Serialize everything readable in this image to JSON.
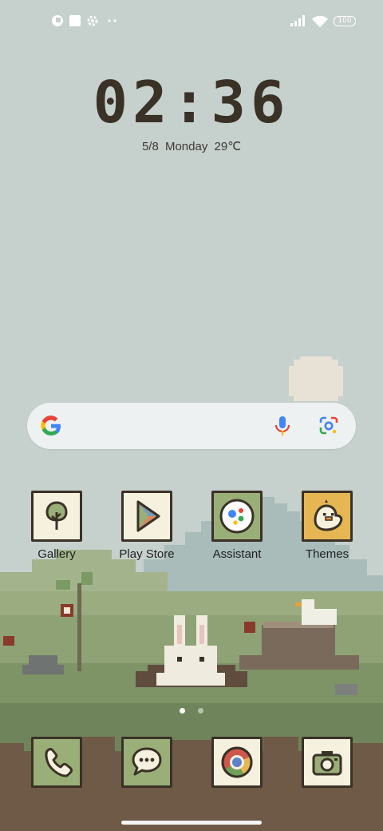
{
  "status_bar": {
    "battery": "100",
    "icons": [
      "pixel-app-icon",
      "square-notification-icon",
      "settings-gear-icon",
      "more-dots-icon",
      "signal-icon",
      "wifi-icon",
      "battery-icon"
    ]
  },
  "lock": {
    "time": "02:36",
    "date": "5/8  Monday  29℃"
  },
  "search": {
    "icons": [
      "google-g-icon",
      "mic-icon",
      "lens-icon"
    ]
  },
  "apps": [
    {
      "label": "Gallery",
      "icon": "tree-icon"
    },
    {
      "label": "Play Store",
      "icon": "play-store-icon"
    },
    {
      "label": "Assistant",
      "icon": "assistant-icon"
    },
    {
      "label": "Themes",
      "icon": "chick-icon"
    }
  ],
  "dock": [
    {
      "icon": "phone-icon"
    },
    {
      "icon": "messages-icon"
    },
    {
      "icon": "chrome-icon"
    },
    {
      "icon": "camera-icon"
    }
  ],
  "page_indicator": {
    "pages": 2,
    "current": 1
  },
  "colors": {
    "sky": "#c6d0cd",
    "ink": "#3a3127",
    "tile_cream": "#f6f1df",
    "tile_green": "#9aae78",
    "tile_yellow": "#e6b653",
    "grass": "#7e9366",
    "dirt": "#6f5a47"
  }
}
